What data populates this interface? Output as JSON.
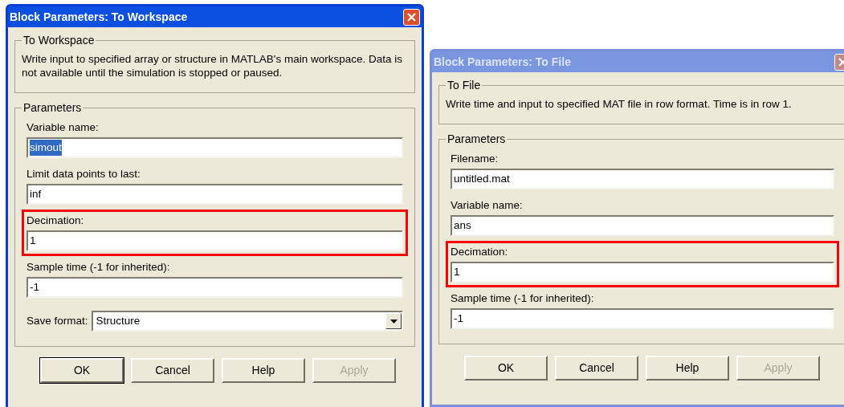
{
  "windows": [
    {
      "title": "Block Parameters: To Workspace",
      "active": true,
      "description_group": {
        "legend": "To Workspace",
        "text": "Write input to specified array or structure in MATLAB's main workspace. Data is not available until the simulation is stopped or paused."
      },
      "parameters": {
        "legend": "Parameters",
        "fields": [
          {
            "kind": "text",
            "label": "Variable name:",
            "value": "simout",
            "text_selected": true,
            "highlighted": false
          },
          {
            "kind": "text",
            "label": "Limit data points to last:",
            "value": "inf",
            "text_selected": false,
            "highlighted": false
          },
          {
            "kind": "text",
            "label": "Decimation:",
            "value": "1",
            "text_selected": false,
            "highlighted": true
          },
          {
            "kind": "text",
            "label": "Sample time (-1 for inherited):",
            "value": "-1",
            "text_selected": false,
            "highlighted": false
          },
          {
            "kind": "select",
            "label": "Save format:",
            "value": "Structure",
            "text_selected": false,
            "highlighted": false
          }
        ]
      },
      "buttons": [
        {
          "label": "OK",
          "default": true,
          "disabled": false
        },
        {
          "label": "Cancel",
          "default": false,
          "disabled": false
        },
        {
          "label": "Help",
          "default": false,
          "disabled": false
        },
        {
          "label": "Apply",
          "default": false,
          "disabled": true
        }
      ]
    },
    {
      "title": "Block Parameters: To File",
      "active": false,
      "description_group": {
        "legend": "To File",
        "text": "Write time and input to specified MAT file in row format.  Time is in row 1."
      },
      "parameters": {
        "legend": "Parameters",
        "fields": [
          {
            "kind": "text",
            "label": "Filename:",
            "value": "untitled.mat",
            "text_selected": false,
            "highlighted": false
          },
          {
            "kind": "text",
            "label": "Variable name:",
            "value": "ans",
            "text_selected": false,
            "highlighted": false
          },
          {
            "kind": "text",
            "label": "Decimation:",
            "value": "1",
            "text_selected": false,
            "highlighted": true
          },
          {
            "kind": "text",
            "label": "Sample time (-1 for inherited):",
            "value": "-1",
            "text_selected": false,
            "highlighted": false
          }
        ]
      },
      "buttons": [
        {
          "label": "OK",
          "default": false,
          "disabled": false
        },
        {
          "label": "Cancel",
          "default": false,
          "disabled": false
        },
        {
          "label": "Help",
          "default": false,
          "disabled": false
        },
        {
          "label": "Apply",
          "default": false,
          "disabled": true
        }
      ]
    }
  ]
}
